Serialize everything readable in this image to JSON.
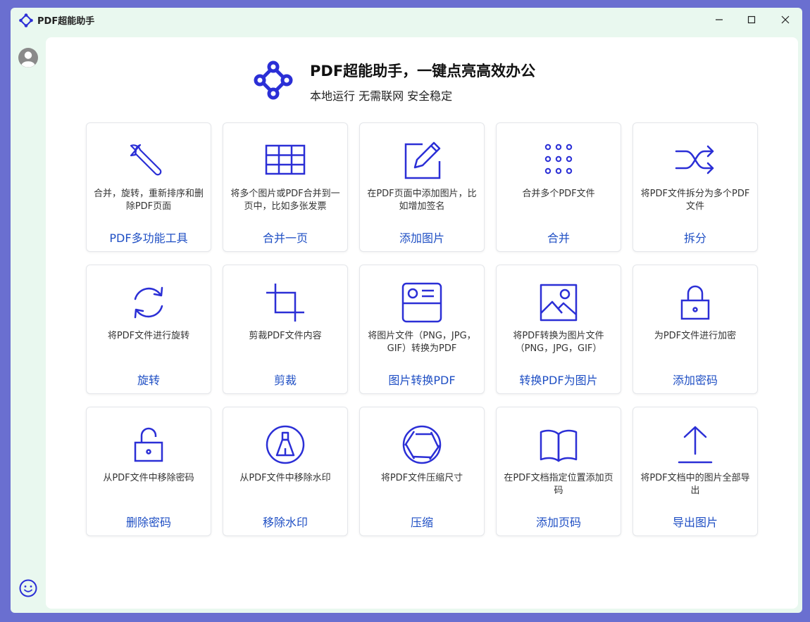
{
  "app": {
    "title": "PDF超能助手"
  },
  "hero": {
    "title": "PDF超能助手，一键点亮高效办公",
    "subtitle": "本地运行 无需联网 安全稳定"
  },
  "colors": {
    "accent": "#2b2fd6",
    "title_link": "#1f4fc4",
    "sidebar_bg": "#e9f8ef"
  },
  "cards": [
    {
      "icon": "wrench-icon",
      "desc": "合并，旋转，重新排序和删除PDF页面",
      "title": "PDF多功能工具"
    },
    {
      "icon": "table-icon",
      "desc": "将多个图片或PDF合并到一页中，比如多张发票",
      "title": "合并一页"
    },
    {
      "icon": "edit-icon",
      "desc": "在PDF页面中添加图片，比如增加签名",
      "title": "添加图片"
    },
    {
      "icon": "dots-grid-icon",
      "desc": "合并多个PDF文件",
      "title": "合并"
    },
    {
      "icon": "shuffle-icon",
      "desc": "将PDF文件拆分为多个PDF文件",
      "title": "拆分"
    },
    {
      "icon": "rotate-icon",
      "desc": "将PDF文件进行旋转",
      "title": "旋转"
    },
    {
      "icon": "crop-icon",
      "desc": "剪裁PDF文件内容",
      "title": "剪裁"
    },
    {
      "icon": "image-card-icon",
      "desc": "将图片文件（PNG，JPG，GIF）转换为PDF",
      "title": "图片转换PDF"
    },
    {
      "icon": "image-icon",
      "desc": "将PDF转换为图片文件（PNG，JPG，GIF）",
      "title": "转换PDF为图片"
    },
    {
      "icon": "lock-icon",
      "desc": "为PDF文件进行加密",
      "title": "添加密码"
    },
    {
      "icon": "unlock-icon",
      "desc": "从PDF文件中移除密码",
      "title": "删除密码"
    },
    {
      "icon": "eraser-icon",
      "desc": "从PDF文件中移除水印",
      "title": "移除水印"
    },
    {
      "icon": "aperture-icon",
      "desc": "将PDF文件压缩尺寸",
      "title": "压缩"
    },
    {
      "icon": "book-icon",
      "desc": "在PDF文档指定位置添加页码",
      "title": "添加页码"
    },
    {
      "icon": "upload-icon",
      "desc": "将PDF文档中的图片全部导出",
      "title": "导出图片"
    }
  ]
}
